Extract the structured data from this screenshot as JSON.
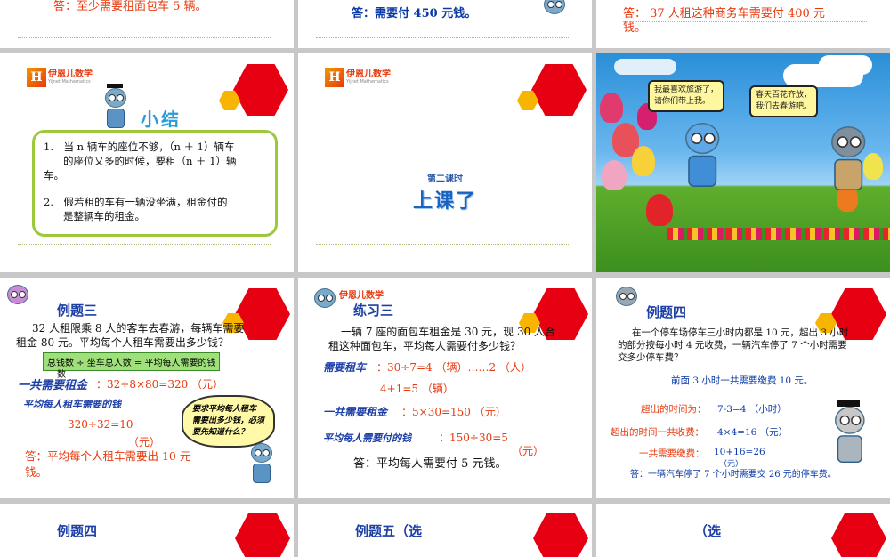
{
  "row0": {
    "s1_answer": "答：至少需要租面包车 5 辆。",
    "s2_answer": "答：需要付 450 元钱。",
    "s3_answer_l1": "答： 37 人租这种商务车需要付 400 元",
    "s3_answer_l2": "钱。"
  },
  "brand": {
    "logo_glyph": "H",
    "name": "伊恩儿数学",
    "sub": "Yijnet Mathematics"
  },
  "summary": {
    "title": "小结",
    "item1_l1": "1.　当 n 辆车的座位不够，（n ＋ 1）辆车",
    "item1_l2": "的座位又多的时候，要租（n ＋ 1）辆",
    "item1_l3": "车。",
    "item2_l1": "2.　假若租的车有一辆没坐满，租金付的",
    "item2_l2": "是整辆车的租金。"
  },
  "lesson": {
    "subtitle": "第二课时",
    "title": "上课了"
  },
  "spring": {
    "bubble1_l1": "我最喜欢旅游了，",
    "bubble1_l2": "请你们带上我。",
    "bubble2_l1": "春天百花齐放，",
    "bubble2_l2": "我们去春游吧。"
  },
  "example3": {
    "title": "例题三",
    "problem_l1": "32 人租限乘 8 人的客车去春游，每辆车需要",
    "problem_l2": "租金 80 元。平均每个人租车需要出多少钱？",
    "hint": "总钱数 ÷ 坐车总人数 = 平均每人需要的钱",
    "hint_tail": "数",
    "label_total": "一共需要租金",
    "calc_total": "：32÷8×80=320 （元）",
    "label_each": "平均每人租车需要的钱",
    "calc_each_l1": "320÷32=10",
    "calc_each_l2": "（元）",
    "thought_l1": "要求平均每人租车",
    "thought_l2": "需要出多少钱，必须",
    "thought_l3": "要先知道什么？",
    "answer_l1": "答：平均每个人租车需要出 10 元",
    "answer_l2": "钱。"
  },
  "practice3": {
    "title": "练习三",
    "problem_l1": "一辆 7 座的面包车租金是 30 元，现 30 人合",
    "problem_l2": "租这种面包车，平均每人需要付多少钱？",
    "label_cars": "需要租车",
    "calc_cars": "：30÷7=4 （辆）……2 （人）",
    "calc_cars2": "4+1=5 （辆）",
    "label_total": "一共需要租金",
    "calc_total": "：5×30=150 （元）",
    "label_each": "平均每人需要付的钱",
    "calc_each": "：150÷30=5",
    "calc_each_unit": "（元）",
    "answer": "答：平均每人需要付 5 元钱。"
  },
  "example4": {
    "title": "例题四",
    "problem_l1": "在一个停车场停车三小时内都是 10 元，超出 3 小时",
    "problem_l2": "的部分按每小时 4 元收费，一辆汽车停了 7 个小时需要",
    "problem_l3": "交多少停车费？",
    "line1": "前面 3 小时一共需要缴费 10 元。",
    "line2_label": "超出的时间为：",
    "line2_calc": "7-3=4 （小时）",
    "line3_label": "超出的时间一共收费：",
    "line3_calc": "4×4=16 （元）",
    "line4_label": "一共需要缴费：",
    "line4_calc": "10+16=26",
    "line4_unit": "（元）",
    "answer": "答：一辆汽车停了 7 个小时需要交 26 元的停车费。"
  },
  "row3": {
    "s1_title": "例题四",
    "s2_title": "例题五（选",
    "s3_title": "（选"
  },
  "colors": {
    "red": "#e60012",
    "yellow": "#f7b500",
    "blue": "#1d3fa6",
    "green": "#9bc93a"
  }
}
